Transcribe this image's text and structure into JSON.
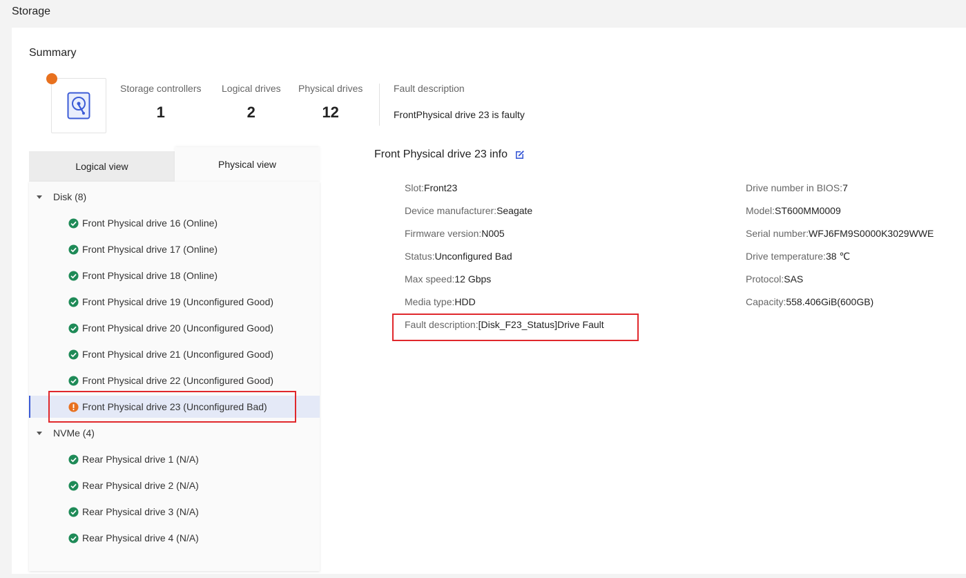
{
  "page_title": "Storage",
  "summary": {
    "title": "Summary",
    "stats": [
      {
        "label": "Storage controllers",
        "value": "1"
      },
      {
        "label": "Logical drives",
        "value": "2"
      },
      {
        "label": "Physical drives",
        "value": "12"
      }
    ],
    "fault_label": "Fault description",
    "fault_value": "FrontPhysical drive 23 is faulty"
  },
  "tabs": {
    "logical": "Logical view",
    "physical": "Physical view",
    "active": "physical"
  },
  "tree": {
    "disk_group": "Disk (8)",
    "disk_items": [
      {
        "label": "Front Physical drive 16 (Online)",
        "status": "ok"
      },
      {
        "label": "Front Physical drive 17 (Online)",
        "status": "ok"
      },
      {
        "label": "Front Physical drive 18 (Online)",
        "status": "ok"
      },
      {
        "label": "Front Physical drive 19 (Unconfigured Good)",
        "status": "ok"
      },
      {
        "label": "Front Physical drive 20 (Unconfigured Good)",
        "status": "ok"
      },
      {
        "label": "Front Physical drive 21 (Unconfigured Good)",
        "status": "ok"
      },
      {
        "label": "Front Physical drive 22 (Unconfigured Good)",
        "status": "ok"
      },
      {
        "label": "Front Physical drive 23 (Unconfigured Bad)",
        "status": "warning"
      }
    ],
    "nvme_group": "NVMe (4)",
    "nvme_items": [
      {
        "label": "Rear Physical drive 1 (N/A)",
        "status": "ok"
      },
      {
        "label": "Rear Physical drive 2 (N/A)",
        "status": "ok"
      },
      {
        "label": "Rear Physical drive 3 (N/A)",
        "status": "ok"
      },
      {
        "label": "Rear Physical drive 4 (N/A)",
        "status": "ok"
      }
    ]
  },
  "detail": {
    "title": "Front Physical drive 23 info",
    "left": [
      {
        "k": "Slot:",
        "v": "Front23"
      },
      {
        "k": "Device manufacturer:",
        "v": "Seagate"
      },
      {
        "k": "Firmware version:",
        "v": "N005"
      },
      {
        "k": "Status:",
        "v": "Unconfigured Bad"
      },
      {
        "k": "Max speed:",
        "v": "12 Gbps"
      },
      {
        "k": "Media type:",
        "v": "HDD"
      },
      {
        "k": "Fault description:",
        "v": "[Disk_F23_Status]Drive Fault"
      }
    ],
    "right": [
      {
        "k": "Drive number in BIOS:",
        "v": "7"
      },
      {
        "k": "Model:",
        "v": "ST600MM0009"
      },
      {
        "k": "Serial number:",
        "v": "WFJ6FM9S0000K3029WWE"
      },
      {
        "k": "Drive temperature:",
        "v": "38 ℃"
      },
      {
        "k": "Protocol:",
        "v": "SAS"
      },
      {
        "k": "Capacity:",
        "v": "558.406GiB(600GB)"
      }
    ]
  },
  "colors": {
    "ok": "#1e8a57",
    "warning": "#e8711f",
    "highlight": "#e0272b",
    "accent": "#3b5bd6"
  }
}
